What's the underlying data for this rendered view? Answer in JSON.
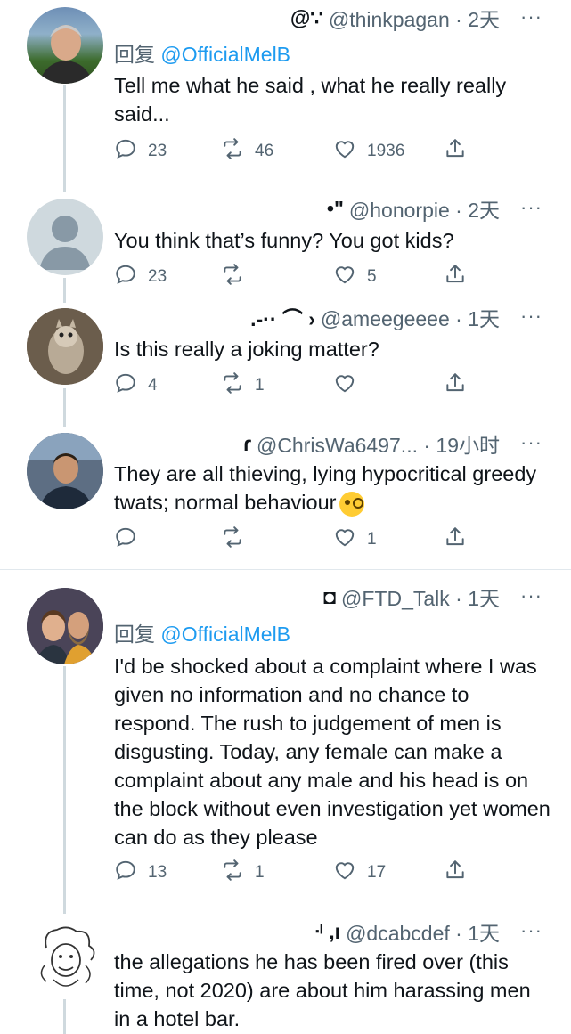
{
  "tweets": [
    {
      "name": "@∵",
      "meta": "@thinkpagan · 2天",
      "reply_prefix": "回复",
      "reply_to": "@OfficialMelB",
      "text": "Tell me what he said , what he really really said...",
      "replies": "23",
      "retweets": "46",
      "likes": "1936"
    },
    {
      "name": "•\"",
      "meta": "@honorpie · 2天",
      "text": "You think that’s funny? You got kids?",
      "replies": "23",
      "retweets": "",
      "likes": "5"
    },
    {
      "name": ".-·· ⌒ ›",
      "meta": "@ameegeeee · 1天",
      "text": "Is this really a joking matter?",
      "replies": "4",
      "retweets": "1",
      "likes": ""
    },
    {
      "name": "ɾ",
      "meta": "@ChrisWa6497... · 19小时",
      "text": "They are all thieving, lying hypocritical greedy twats; normal behaviour",
      "replies": "",
      "retweets": "",
      "likes": "1"
    },
    {
      "name": "◘",
      "meta": "@FTD_Talk · 1天",
      "reply_prefix": "回复",
      "reply_to": "@OfficialMelB",
      "text": "I'd be shocked about a complaint where I was given no information and no chance to respond. The rush to judgement of men is disgusting. Today, any female can make a complaint about any male and his head is on the block without even investigation yet women can do as they please",
      "replies": "13",
      "retweets": "1",
      "likes": "17"
    },
    {
      "name": "ᐧᴵ ,ı",
      "meta": "@dcabcdef · 1天",
      "text": "the allegations he has been fired over (this time, not 2020) are about him harassing men in a hotel bar."
    }
  ],
  "more_glyph": "···",
  "colors": {
    "link": "#1d9bf0",
    "muted": "#536471",
    "thread": "#cfd9de"
  }
}
